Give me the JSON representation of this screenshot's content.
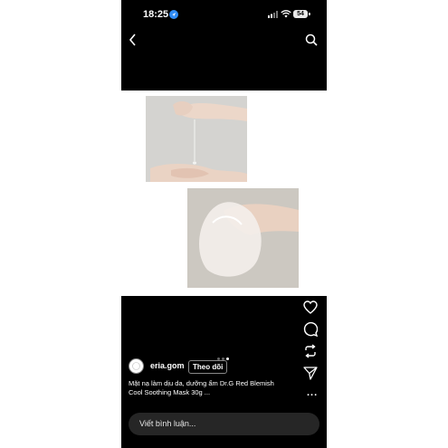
{
  "status_bar": {
    "time": "18:25",
    "battery": "54"
  },
  "nav": {
    "back_icon": "chevron-left-icon",
    "search_icon": "search-icon"
  },
  "carousel": {
    "page_count": 3,
    "active_index": 2
  },
  "actions": [
    "heart-icon",
    "comment-icon",
    "repost-icon",
    "send-icon"
  ],
  "more_label": "...",
  "post": {
    "username": "eria.gom",
    "follow_label": "Theo dõi",
    "caption_line1": "Mặt nạ làm dịu da, dưỡng ẩm Dr.G Red Blemish",
    "caption_line2": "Cool Soothing Mask 30g ..."
  },
  "comment": {
    "placeholder": "Viết bình luận..."
  }
}
